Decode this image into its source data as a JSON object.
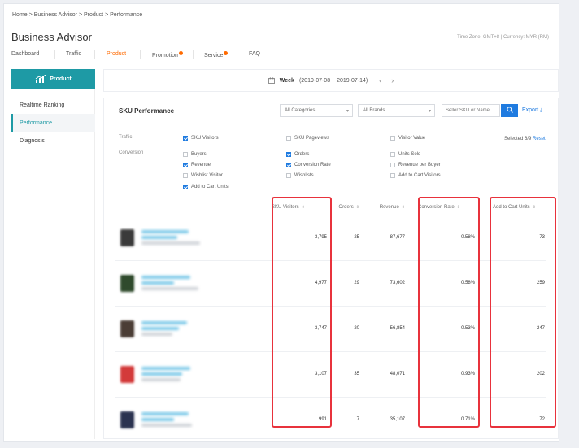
{
  "breadcrumb": {
    "items": [
      "Home",
      "Business Advisor",
      "Product",
      "Performance"
    ],
    "separator": ">"
  },
  "app": {
    "title": "Business Advisor",
    "timezone": "Time Zone: GMT+8 | Currency: MYR (RM)"
  },
  "topnav": {
    "items": [
      {
        "label": "Dashboard",
        "active": false,
        "dot": false
      },
      {
        "label": "Traffic",
        "active": false,
        "dot": false
      },
      {
        "label": "Product",
        "active": true,
        "dot": false
      },
      {
        "label": "Promotion",
        "active": false,
        "dot": true
      },
      {
        "label": "Service",
        "active": false,
        "dot": true
      },
      {
        "label": "FAQ",
        "active": false,
        "dot": false
      }
    ]
  },
  "sidebar": {
    "header": "Product",
    "items": [
      {
        "label": "Realtime Ranking",
        "active": false
      },
      {
        "label": "Performance",
        "active": true
      },
      {
        "label": "Diagnosis",
        "active": false
      }
    ]
  },
  "period": {
    "label": "Week",
    "range": "(2019-07-08 ~ 2019-07-14)",
    "prev": "‹",
    "next": "›"
  },
  "panel": {
    "title": "SKU Performance",
    "category_select": "All Categories",
    "brand_select": "All Brands",
    "search_placeholder": "Seller SKU or Name",
    "export_label": "Export"
  },
  "metrics": {
    "traffic_label": "Traffic",
    "conversion_label": "Conversion",
    "selected_text": "Selected 6/9",
    "reset_label": "Reset",
    "traffic": [
      {
        "label": "SKU Visitors",
        "checked": true
      },
      {
        "label": "SKU Pageviews",
        "checked": false
      },
      {
        "label": "Visitor Value",
        "checked": false
      }
    ],
    "conversion": [
      {
        "label": "Buyers",
        "checked": false
      },
      {
        "label": "Orders",
        "checked": true
      },
      {
        "label": "Units Sold",
        "checked": false
      },
      {
        "label": "Revenue",
        "checked": true
      },
      {
        "label": "Conversion Rate",
        "checked": true
      },
      {
        "label": "Revenue per Buyer",
        "checked": false
      },
      {
        "label": "Wishlist Visitor",
        "checked": false
      },
      {
        "label": "Wishlists",
        "checked": false
      },
      {
        "label": "Add to Cart Visitors",
        "checked": false
      },
      {
        "label": "Add to Cart Units",
        "checked": true
      }
    ]
  },
  "table": {
    "sort_icon": "⇕",
    "columns": [
      "SKU Visitors",
      "Orders",
      "Revenue",
      "Conversion Rate",
      "Add to Cart Units"
    ],
    "rows": [
      {
        "sku_visitors": "3,795",
        "orders": "25",
        "revenue": "87,677",
        "conversion_rate": "0.58%",
        "add_to_cart_units": "73",
        "thumb_color": "#3a3a3a"
      },
      {
        "sku_visitors": "4,977",
        "orders": "29",
        "revenue": "73,602",
        "conversion_rate": "0.58%",
        "add_to_cart_units": "259",
        "thumb_color": "#2f4a2c"
      },
      {
        "sku_visitors": "3,747",
        "orders": "20",
        "revenue": "56,854",
        "conversion_rate": "0.53%",
        "add_to_cart_units": "247",
        "thumb_color": "#4b3d35"
      },
      {
        "sku_visitors": "3,107",
        "orders": "35",
        "revenue": "48,071",
        "conversion_rate": "0.93%",
        "add_to_cart_units": "202",
        "thumb_color": "#d33a3a"
      },
      {
        "sku_visitors": "991",
        "orders": "7",
        "revenue": "35,107",
        "conversion_rate": "0.71%",
        "add_to_cart_units": "72",
        "thumb_color": "#2b3350"
      }
    ]
  },
  "colors": {
    "accent_teal": "#1e9aa5",
    "active_orange": "#ff6a00",
    "primary_blue": "#1f7be0",
    "highlight_red": "#e8323c",
    "blurred_link": "#7cc9e8"
  }
}
